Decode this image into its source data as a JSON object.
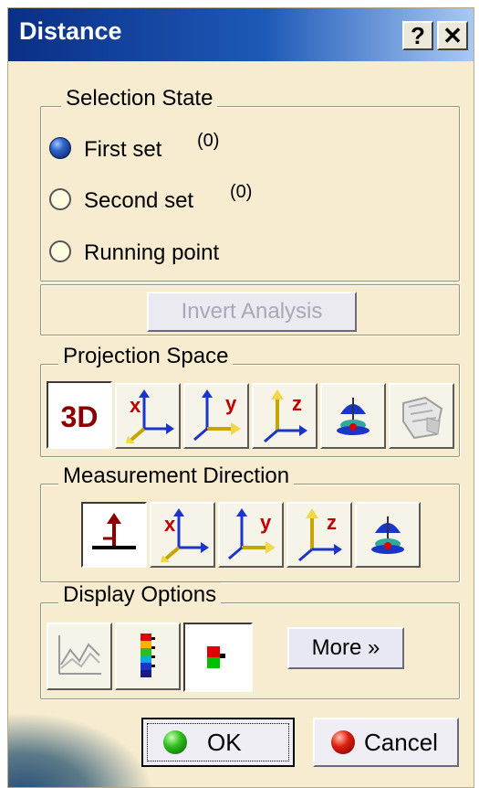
{
  "window": {
    "title": "Distance",
    "help_label": "?",
    "close_label": "✕"
  },
  "selection_state": {
    "legend": "Selection State",
    "options": [
      {
        "label": "First set",
        "count": "(0)",
        "selected": true
      },
      {
        "label": "Second set",
        "count": "(0)",
        "selected": false
      },
      {
        "label": "Running point",
        "selected": false
      }
    ]
  },
  "invert_analysis": {
    "label": "Invert Analysis",
    "enabled": false
  },
  "projection_space": {
    "legend": "Projection Space",
    "buttons": [
      {
        "icon": "3d-icon",
        "label": "3D"
      },
      {
        "icon": "x-axis-icon",
        "label": "x"
      },
      {
        "icon": "y-axis-icon",
        "label": "y"
      },
      {
        "icon": "z-axis-icon",
        "label": "z"
      },
      {
        "icon": "planar-projection-icon"
      },
      {
        "icon": "surface-projection-icon"
      }
    ]
  },
  "measurement_direction": {
    "legend": "Measurement Direction",
    "buttons": [
      {
        "icon": "normal-direction-icon"
      },
      {
        "icon": "x-axis-icon",
        "label": "x"
      },
      {
        "icon": "y-axis-icon",
        "label": "y"
      },
      {
        "icon": "z-axis-icon",
        "label": "z"
      },
      {
        "icon": "planar-direction-icon"
      }
    ]
  },
  "display_options": {
    "legend": "Display Options",
    "buttons": [
      {
        "icon": "graph-icon"
      },
      {
        "icon": "color-scale-icon"
      },
      {
        "icon": "color-patch-icon"
      }
    ],
    "more_label": "More »"
  },
  "footer": {
    "ok_label": "OK",
    "cancel_label": "Cancel"
  },
  "colors": {
    "titlebar": "#0a2f86",
    "dialog_bg": "#f7ecd0",
    "accent_blue": "#1a36c8",
    "accent_yellow": "#f0d84a"
  }
}
